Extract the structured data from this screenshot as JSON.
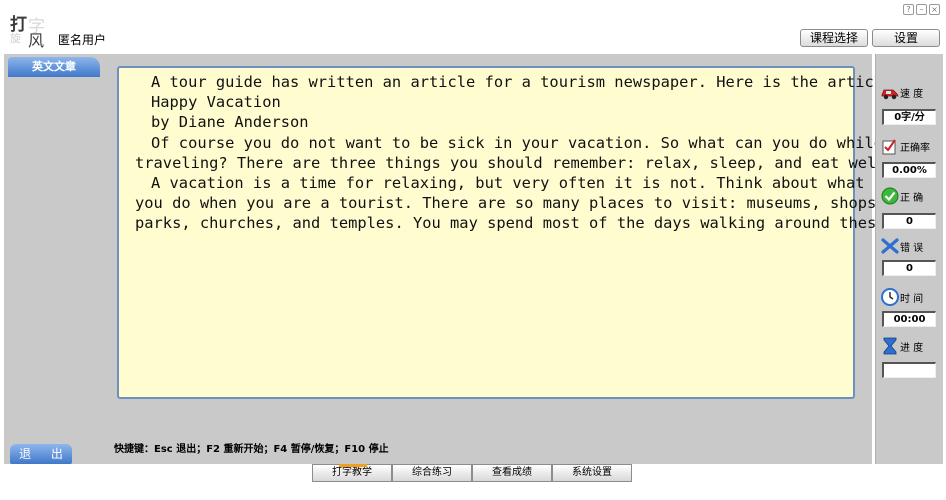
{
  "app": {
    "logo_chars": [
      "打",
      "字",
      "旋",
      "风"
    ],
    "username": "匿名用户",
    "window_controls": [
      "?",
      "–",
      "×"
    ]
  },
  "header": {
    "course_button": "课程选择",
    "settings_button": "设置"
  },
  "main": {
    "tab_label": "英文文章",
    "article_lines": [
      "A tour guide has written an article for a tourism newspaper. Here is the article.",
      "Happy Vacation",
      "by Diane Anderson",
      "Of course you do not want to be sick in your vacation. So what can you do while",
      "traveling? There are three things you should remember: relax, sleep, and eat well.",
      "A vacation is a time for relaxing, but very often it is not. Think about what",
      "you do when you are a tourist. There are so many places to visit: museums, shops,",
      "parks, churches, and temples. You may spend most of the days walking around these"
    ],
    "exit_button": "退 出",
    "shortcuts": "快捷键：Esc 退出；F2 重新开始；F4 暂停/恢复；F10 停止"
  },
  "stats": {
    "speed": {
      "label": "速  度",
      "value": "0字/分",
      "icon": "car-icon"
    },
    "accuracy": {
      "label": "正确率",
      "value": "0.00%",
      "icon": "check-pen-icon"
    },
    "correct": {
      "label": "正  确",
      "value": "0",
      "icon": "green-check-icon"
    },
    "errors": {
      "label": "错  误",
      "value": "0",
      "icon": "cross-icon"
    },
    "time": {
      "label": "时  间",
      "value": "00:00",
      "icon": "clock-icon"
    },
    "progress": {
      "label": "进  度",
      "value": "",
      "icon": "hourglass-icon",
      "fraction": 0
    }
  },
  "bottom_tabs": [
    "打字教学",
    "综合练习",
    "查看成绩",
    "系统设置"
  ],
  "colors": {
    "accent_blue": "#3f78c9",
    "text_area": "#fffdd0",
    "panel_gray": "#c9c9c9"
  }
}
